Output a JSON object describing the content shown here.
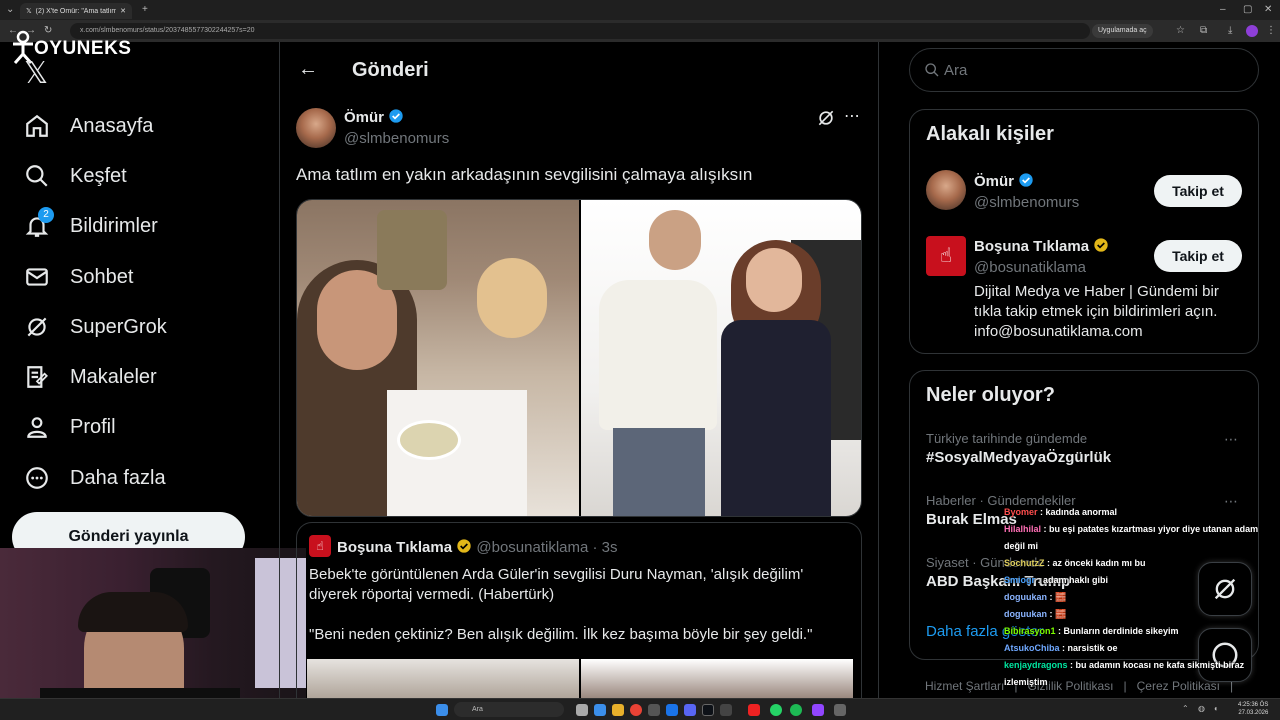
{
  "browser": {
    "tabs": [
      {
        "label": "(2) X'te Ömür: \"Ama tatlım en y..."
      }
    ],
    "url": "x.com/slmbenomurs/status/2037485577302244257s=20",
    "open_in_app": "Uygulamada aç"
  },
  "overlay": {
    "logo": "OYUNEKS"
  },
  "nav": {
    "items": [
      {
        "label": "Anasayfa"
      },
      {
        "label": "Keşfet"
      },
      {
        "label": "Bildirimler",
        "badge": "2"
      },
      {
        "label": "Sohbet"
      },
      {
        "label": "SuperGrok"
      },
      {
        "label": "Makaleler"
      },
      {
        "label": "Profil"
      },
      {
        "label": "Daha fazla"
      }
    ],
    "post_button": "Gönderi yayınla"
  },
  "main": {
    "header_title": "Gönderi",
    "post": {
      "author_name": "Ömür",
      "author_handle": "@slmbenomurs",
      "text": "Ama tatlım en yakın arkadaşının sevgilisini çalmaya alışıksın"
    },
    "quote": {
      "author_name": "Boşuna Tıklama",
      "author_handle": "@bosunatiklama",
      "time": "· 3s",
      "text1": "Bebek'te görüntülenen Arda Güler'in sevgilisi Duru Nayman, 'alışık değilim' diyerek röportaj vermedi. (Habertürk)",
      "text2": "\"Beni neden çektiniz? Ben alışık değilim. İlk kez başıma böyle bir şey geldi.\""
    }
  },
  "sidebar": {
    "search_placeholder": "Ara",
    "related_title": "Alakalı kişiler",
    "people": [
      {
        "name": "Ömür",
        "handle": "@slmbenomurs",
        "button": "Takip et"
      },
      {
        "name": "Boşuna Tıklama",
        "handle": "@bosunatiklama",
        "button": "Takip et",
        "bio": "Dijital Medya ve Haber | Gündemi bir tıkla takip etmek için bildirimleri açın. info@bosunatiklama.com"
      }
    ],
    "trends_title": "Neler oluyor?",
    "trends": [
      {
        "context": "Türkiye tarihinde gündemde",
        "name": "#SosyalMedyayaÖzgürlük"
      },
      {
        "context": "Haberler · Gündemdekiler",
        "name": "Burak Elmas"
      },
      {
        "context": "Siyaset · Gündemde",
        "name": "ABD Başkanı Trump"
      }
    ],
    "show_more": "Daha fazla göster",
    "footer": [
      "Hizmet Şartları",
      "|",
      "Gizlilik Politikası",
      "|",
      "Çerez Politikası",
      "|"
    ]
  },
  "chat": [
    {
      "user": "Byomer",
      "color": "#ff4d4d",
      "msg": "kadında anormal"
    },
    {
      "user": "Hilalhilal",
      "color": "#ff6fb5",
      "msg": "bu eşi patates kızartması yiyor diye utanan adam değil mi"
    },
    {
      "user": "SochutzZ",
      "color": "#e0d060",
      "msg": "az önceki kadın mı bu"
    },
    {
      "user": "Smiogr",
      "color": "#4aa3ff",
      "msg": "adam haklı gibi"
    },
    {
      "user": "doguukan",
      "color": "#8ab4ff",
      "msg": "🧱"
    },
    {
      "user": "doguukan",
      "color": "#8ab4ff",
      "msg": "🧱"
    },
    {
      "user": "Bibirasyon1",
      "color": "#7cfc00",
      "msg": "Bunların derdinide sikeyim"
    },
    {
      "user": "AtsukoChiba",
      "color": "#6fa8ff",
      "msg": "narsistik oe"
    },
    {
      "user": "kenjaydragons",
      "color": "#00e5a0",
      "msg": "bu adamın kocası ne kafa sikmişti biraz izlemiştim"
    }
  ],
  "taskbar": {
    "search": "Ara",
    "time": "4:25:36 ÖS",
    "date": "27.03.2026"
  },
  "colors": {
    "accent": "#1d9bf0",
    "gold": "#e2b719",
    "background": "#000000"
  }
}
